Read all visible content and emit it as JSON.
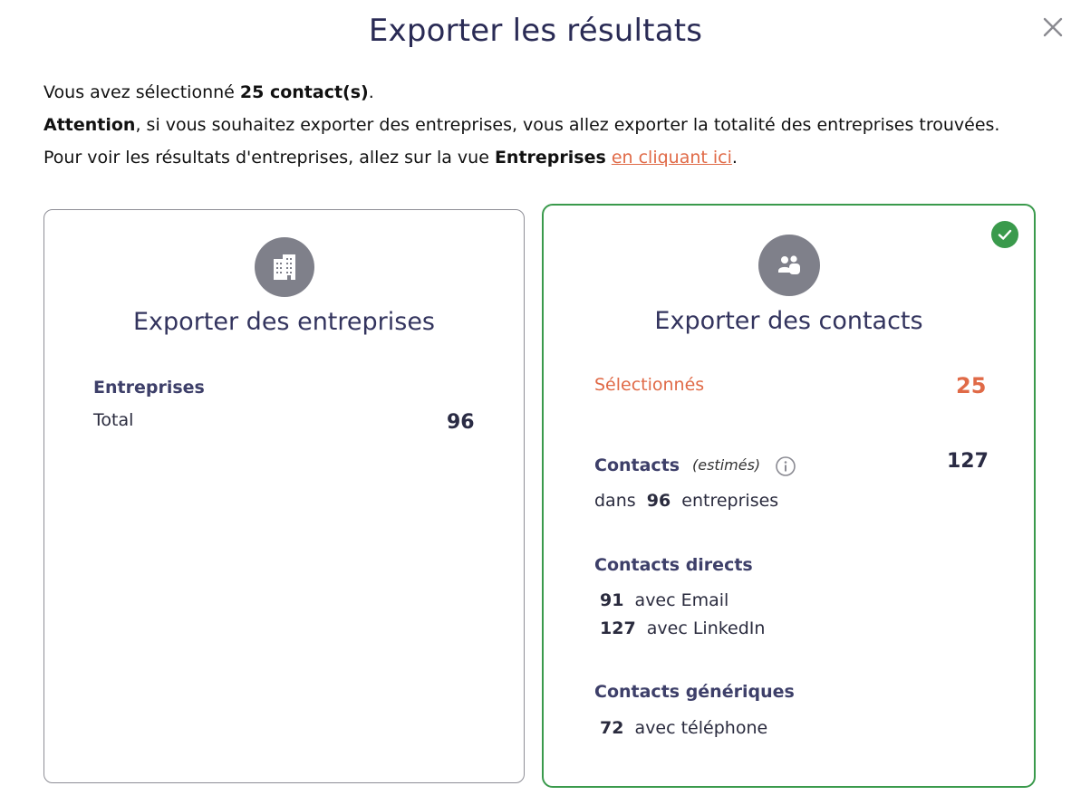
{
  "modal": {
    "title": "Exporter les résultats",
    "close_icon": "close-icon"
  },
  "intro": {
    "line1_prefix": "Vous avez sélectionné ",
    "line1_bold": "25 contact(s)",
    "line1_suffix": ".",
    "line2_bold": "Attention",
    "line2_rest": ", si vous souhaitez exporter des entreprises, vous allez exporter la totalité des entreprises trouvées.",
    "line3_prefix": "Pour voir les résultats d'entreprises, allez sur la vue ",
    "line3_bold": "Entreprises",
    "line3_space": " ",
    "line3_link": "en cliquant ici",
    "line3_suffix": "."
  },
  "companies_card": {
    "icon": "building-icon",
    "title": "Exporter des entreprises",
    "section_label": "Entreprises",
    "total_label": "Total",
    "total_value": "96",
    "selected": false
  },
  "contacts_card": {
    "icon": "users-icon",
    "selected_icon": "check-circle-icon",
    "selected": true,
    "title": "Exporter des contacts",
    "selected_label": "Sélectionnés",
    "selected_value": "25",
    "contacts_label": "Contacts",
    "estimated_label": "(estimés)",
    "info_icon": "info-icon",
    "contacts_value": "127",
    "in_label": "dans",
    "in_value": "96",
    "companies_label": "entreprises",
    "direct_label": "Contacts directs",
    "email_value": "91",
    "email_label": "avec Email",
    "linkedin_value": "127",
    "linkedin_label": "avec LinkedIn",
    "generic_label": "Contacts génériques",
    "phone_value": "72",
    "phone_label": "avec téléphone"
  },
  "colors": {
    "title": "#2a2b55",
    "accent_orange": "#e06a47",
    "selected_green": "#3a9a4c",
    "icon_gray": "#7f808a"
  }
}
